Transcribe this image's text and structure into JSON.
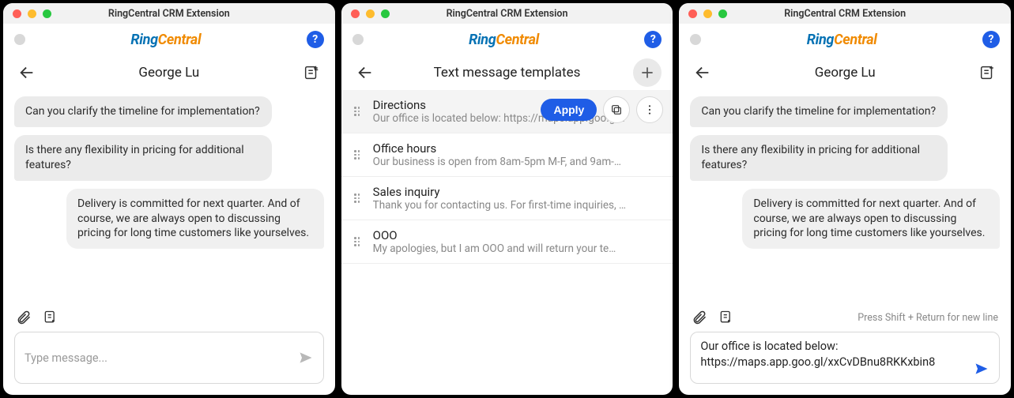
{
  "windows": [
    {
      "title": "RingCentral CRM Extension",
      "header_title": "George Lu",
      "chat": {
        "incoming": [
          "Can you clarify the timeline for implementation?",
          "Is there any flexibility in pricing for additional features?"
        ],
        "outgoing": [
          "Delivery is committed for next quarter. And of course, we are always open to discussing pricing for long time customers like yourselves."
        ]
      },
      "compose_placeholder": "Type message..."
    },
    {
      "title": "RingCentral CRM Extension",
      "header_title": "Text message templates",
      "templates": [
        {
          "title": "Directions",
          "preview": "Our office is located below: https://maps.app.goo.gl…",
          "hover": true
        },
        {
          "title": "Office hours",
          "preview": "Our business is open from 8am-5pm M-F, and 9am-…"
        },
        {
          "title": "Sales inquiry",
          "preview": "Thank you for contacting us. For first-time inquiries, …"
        },
        {
          "title": "OOO",
          "preview": "My apologies, but I am OOO and will return your te…"
        }
      ],
      "apply_label": "Apply"
    },
    {
      "title": "RingCentral CRM Extension",
      "header_title": "George Lu",
      "chat": {
        "incoming": [
          "Can you clarify the timeline for implementation?",
          "Is there any flexibility in pricing for additional features?"
        ],
        "outgoing": [
          "Delivery is committed for next quarter. And of course, we are always open to discussing pricing for long time customers like yourselves."
        ]
      },
      "compose_hint": "Press Shift + Return for new line",
      "compose_value": "Our office is located below: https://maps.app.goo.gl/xxCvDBnu8RKKxbin8"
    }
  ],
  "brand": {
    "ring": "Ring",
    "central": "Central"
  },
  "help": "?"
}
